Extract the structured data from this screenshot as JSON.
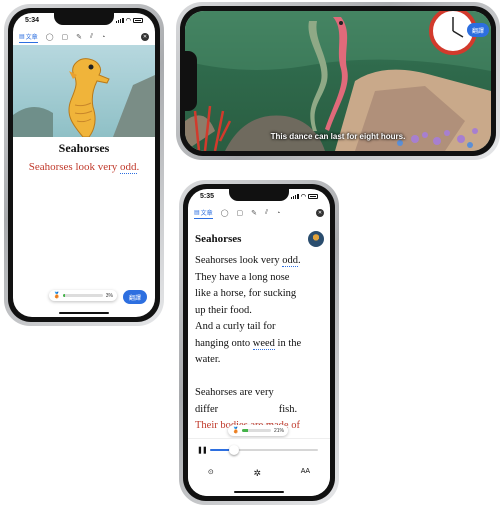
{
  "phone1": {
    "time": "5:34",
    "active_tab": "文章",
    "title": "Seahorses",
    "sentence_start": "Seahorses look very ",
    "sentence_word": "odd",
    "sentence_end": ".",
    "progress_percent": "3%",
    "progress_value": 0.03,
    "button_label": "翻譯"
  },
  "phone2": {
    "subtitle": "This dance can last for eight hours.",
    "button_label": "翻譯"
  },
  "phone3": {
    "time": "5:35",
    "active_tab": "文章",
    "title": "Seahorses",
    "line1_a": "Seahorses look very ",
    "line1_b": "odd",
    "line1_c": ".",
    "line2": "They have a long nose",
    "line3": "like a horse, for sucking",
    "line4": "up their food.",
    "line5": "And a curly tail for",
    "line6_a": "hanging onto ",
    "line6_b": "weed",
    "line6_c": " in the",
    "line7": "water.",
    "line8": "Seahorses are very",
    "line9_a": "differ",
    "line9_b": " fish.",
    "line10": "Their bodies are made of",
    "progress_percent": "21%",
    "progress_value": 0.21,
    "audio_progress": 0.22,
    "text_size_label": "AA"
  },
  "colors": {
    "accent": "#2d6fe0",
    "highlight_red": "#c0392b",
    "progress_green": "#45b34a"
  }
}
